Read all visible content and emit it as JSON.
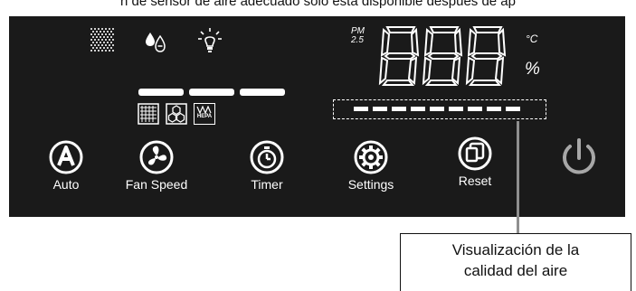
{
  "caption": "n de sensor de aire adecuado sólo está disponible después de ap",
  "display": {
    "pm_label_top": "PM",
    "pm_label_bottom": "2.5",
    "digits": "888",
    "unit_celsius": "°C",
    "unit_percent": "%"
  },
  "indicators": {
    "top_icons": [
      "dust-grid-icon",
      "water-drop-icon",
      "light-bulb-icon"
    ],
    "filter_icons": [
      "pre-filter-icon",
      "carbon-filter-icon",
      "hepa-filter-icon"
    ],
    "hepa_label": "HEPA",
    "air_quality_segments": 9
  },
  "buttons": [
    {
      "id": "auto",
      "label": "Auto",
      "icon": "auto-a-icon"
    },
    {
      "id": "fan-speed",
      "label": "Fan Speed",
      "icon": "fan-icon"
    },
    {
      "id": "timer",
      "label": "Timer",
      "icon": "stopwatch-icon"
    },
    {
      "id": "settings",
      "label": "Settings",
      "icon": "gear-icon"
    },
    {
      "id": "reset",
      "label": "Reset",
      "icon": "copy-reset-icon"
    },
    {
      "id": "power",
      "label": "",
      "icon": "power-icon"
    }
  ],
  "callout": {
    "line1": "Visualización de la",
    "line2": "calidad del aire"
  },
  "colors": {
    "panel": "#1a1a1a",
    "foreground": "#ffffff",
    "power": "#a7a7a7",
    "callout_line": "#8f8f8f"
  }
}
